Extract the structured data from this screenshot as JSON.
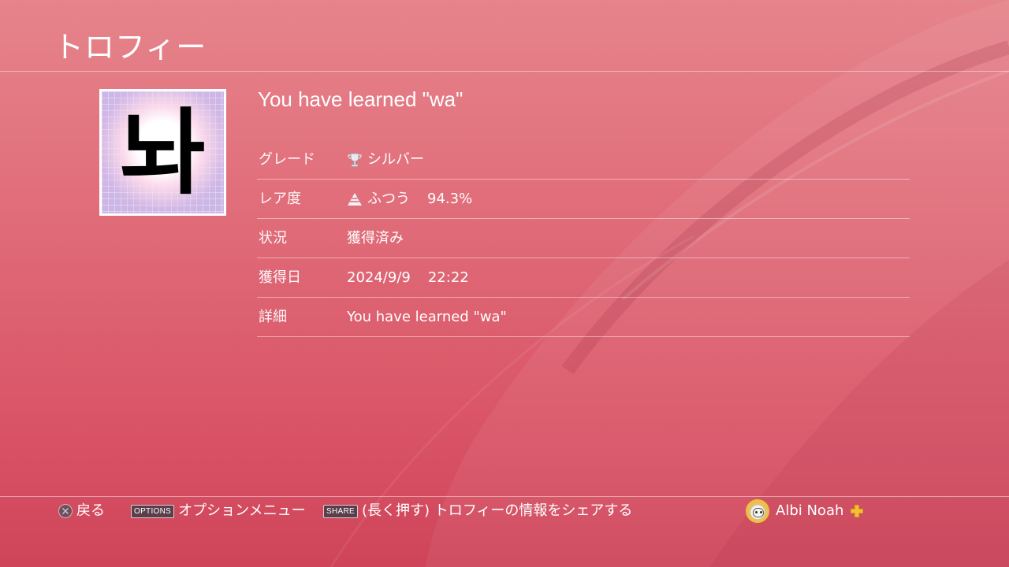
{
  "header": {
    "title": "トロフィー"
  },
  "trophy": {
    "glyph": "놔",
    "name": "You have learned \"wa\""
  },
  "details": [
    {
      "key": "grade",
      "label": "グレード",
      "icon": "silver-trophy-icon",
      "value": "シルバー"
    },
    {
      "key": "rarity",
      "label": "レア度",
      "icon": "rarity-common-icon",
      "value": "ふつう",
      "percent": "94.3%"
    },
    {
      "key": "status",
      "label": "状況",
      "value": "獲得済み"
    },
    {
      "key": "earned_date",
      "label": "獲得日",
      "date": "2024/9/9",
      "time": "22:22"
    },
    {
      "key": "description",
      "label": "詳細",
      "value": "You have learned \"wa\""
    }
  ],
  "footer": {
    "back": {
      "icon": "cross-button-icon",
      "label": "戻る"
    },
    "options": {
      "badge": "OPTIONS",
      "label": "オプションメニュー"
    },
    "share": {
      "badge": "SHARE",
      "label": "(長く押す) トロフィーの情報をシェアする"
    }
  },
  "user": {
    "name": "Albi Noah",
    "plus_icon": "ps-plus-icon"
  },
  "colors": {
    "background_top": "#e6848b",
    "background_bottom": "#cf4459",
    "plus_gold": "#f2c130"
  }
}
